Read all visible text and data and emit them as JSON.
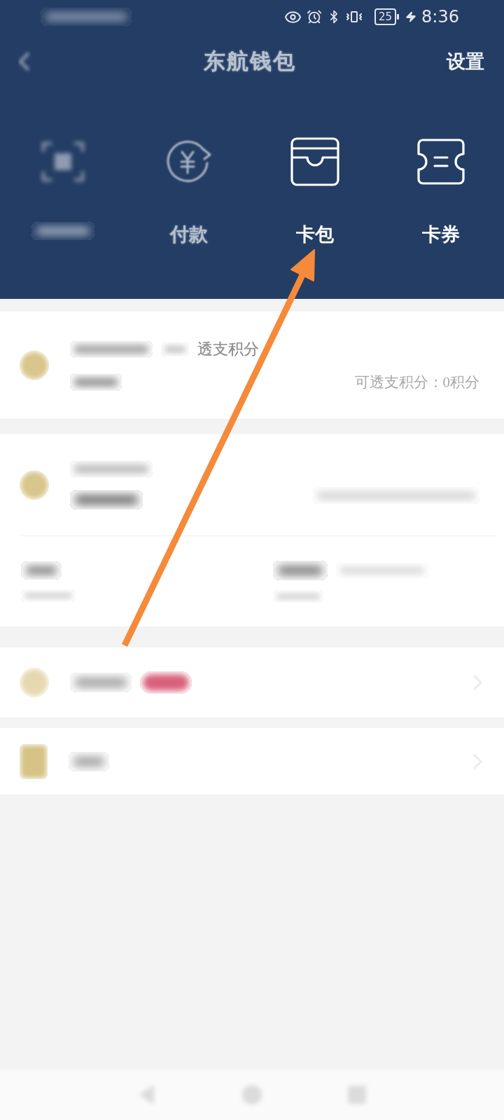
{
  "status_bar": {
    "battery": "25",
    "time": "8:36"
  },
  "nav": {
    "title": "东航钱包",
    "action": "设置"
  },
  "quick_actions": [
    {
      "kind": "scan",
      "blurred": true
    },
    {
      "kind": "pay",
      "label": "付款",
      "blurred": true
    },
    {
      "kind": "wallet",
      "label": "卡包",
      "blurred": false
    },
    {
      "kind": "ticket",
      "label": "卡券",
      "blurred": false
    }
  ],
  "points_card": {
    "note": "透支积分",
    "detail": "可透支积分：0积分"
  },
  "list_rows": [
    {
      "kind": "coin",
      "badge": true
    },
    {
      "kind": "tile",
      "badge": false
    }
  ]
}
